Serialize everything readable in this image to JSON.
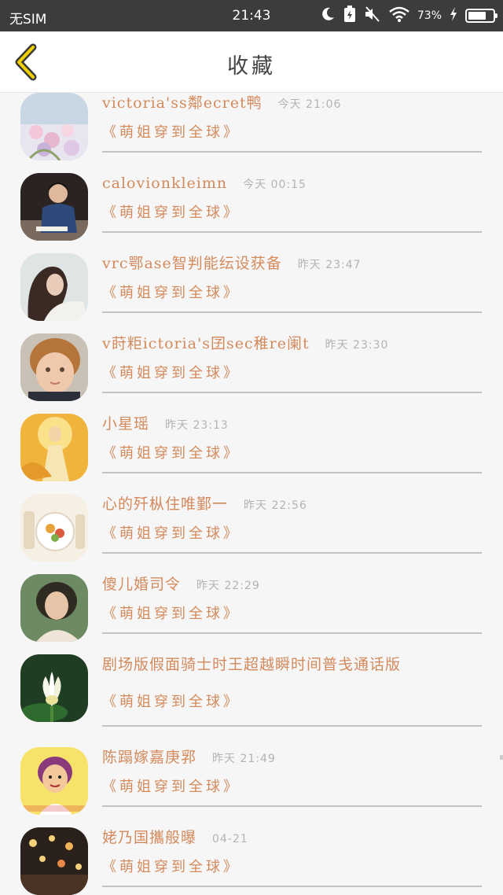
{
  "status_bar": {
    "carrier": "无SIM",
    "time": "21:43",
    "battery_text": "73%",
    "battery_level": 0.73
  },
  "header": {
    "title": "收藏"
  },
  "items": [
    {
      "name": "victoria'ss鄰ecret鸭",
      "time": "今天  21:06",
      "subtitle": "《萌姐穿到全球》",
      "avatar_icon": "flowers-avatar"
    },
    {
      "name": "calovionkleimn",
      "time": "今天  00:15",
      "subtitle": "《萌姐穿到全球》",
      "avatar_icon": "man-avatar"
    },
    {
      "name": "vrc鄂ase智判能纭设获备",
      "time": "昨天  23:47",
      "subtitle": "《萌姐穿到全球》",
      "avatar_icon": "woman-avatar"
    },
    {
      "name": "v莳粔ictoria's囝sec稚re阑t",
      "time": "昨天  23:30",
      "subtitle": "《萌姐穿到全球》",
      "avatar_icon": "child-avatar"
    },
    {
      "name": "小星瑶",
      "time": "昨天  23:13",
      "subtitle": "《萌姐穿到全球》",
      "avatar_icon": "golden-figure-avatar"
    },
    {
      "name": "心的歼枞住唯鄞一",
      "time": "昨天  22:56",
      "subtitle": "《萌姐穿到全球》",
      "avatar_icon": "food-avatar"
    },
    {
      "name": "傻儿婚司令",
      "time": "昨天  22:29",
      "subtitle": "《萌姐穿到全球》",
      "avatar_icon": "portrait-avatar"
    },
    {
      "name": "剧场版假面骑士时王超越瞬时间普戋通话版",
      "time": "",
      "subtitle": "《萌姐穿到全球》",
      "avatar_icon": "lotus-avatar"
    },
    {
      "name": "陈蹋嫁嘉庚郛",
      "time": "昨天  21:49",
      "subtitle": "《萌姐穿到全球》",
      "avatar_icon": "cartoon-avatar"
    },
    {
      "name": "姥乃国攜般曝",
      "time": "04-21",
      "subtitle": "《萌姐穿到全球》",
      "avatar_icon": "lights-avatar"
    }
  ]
}
